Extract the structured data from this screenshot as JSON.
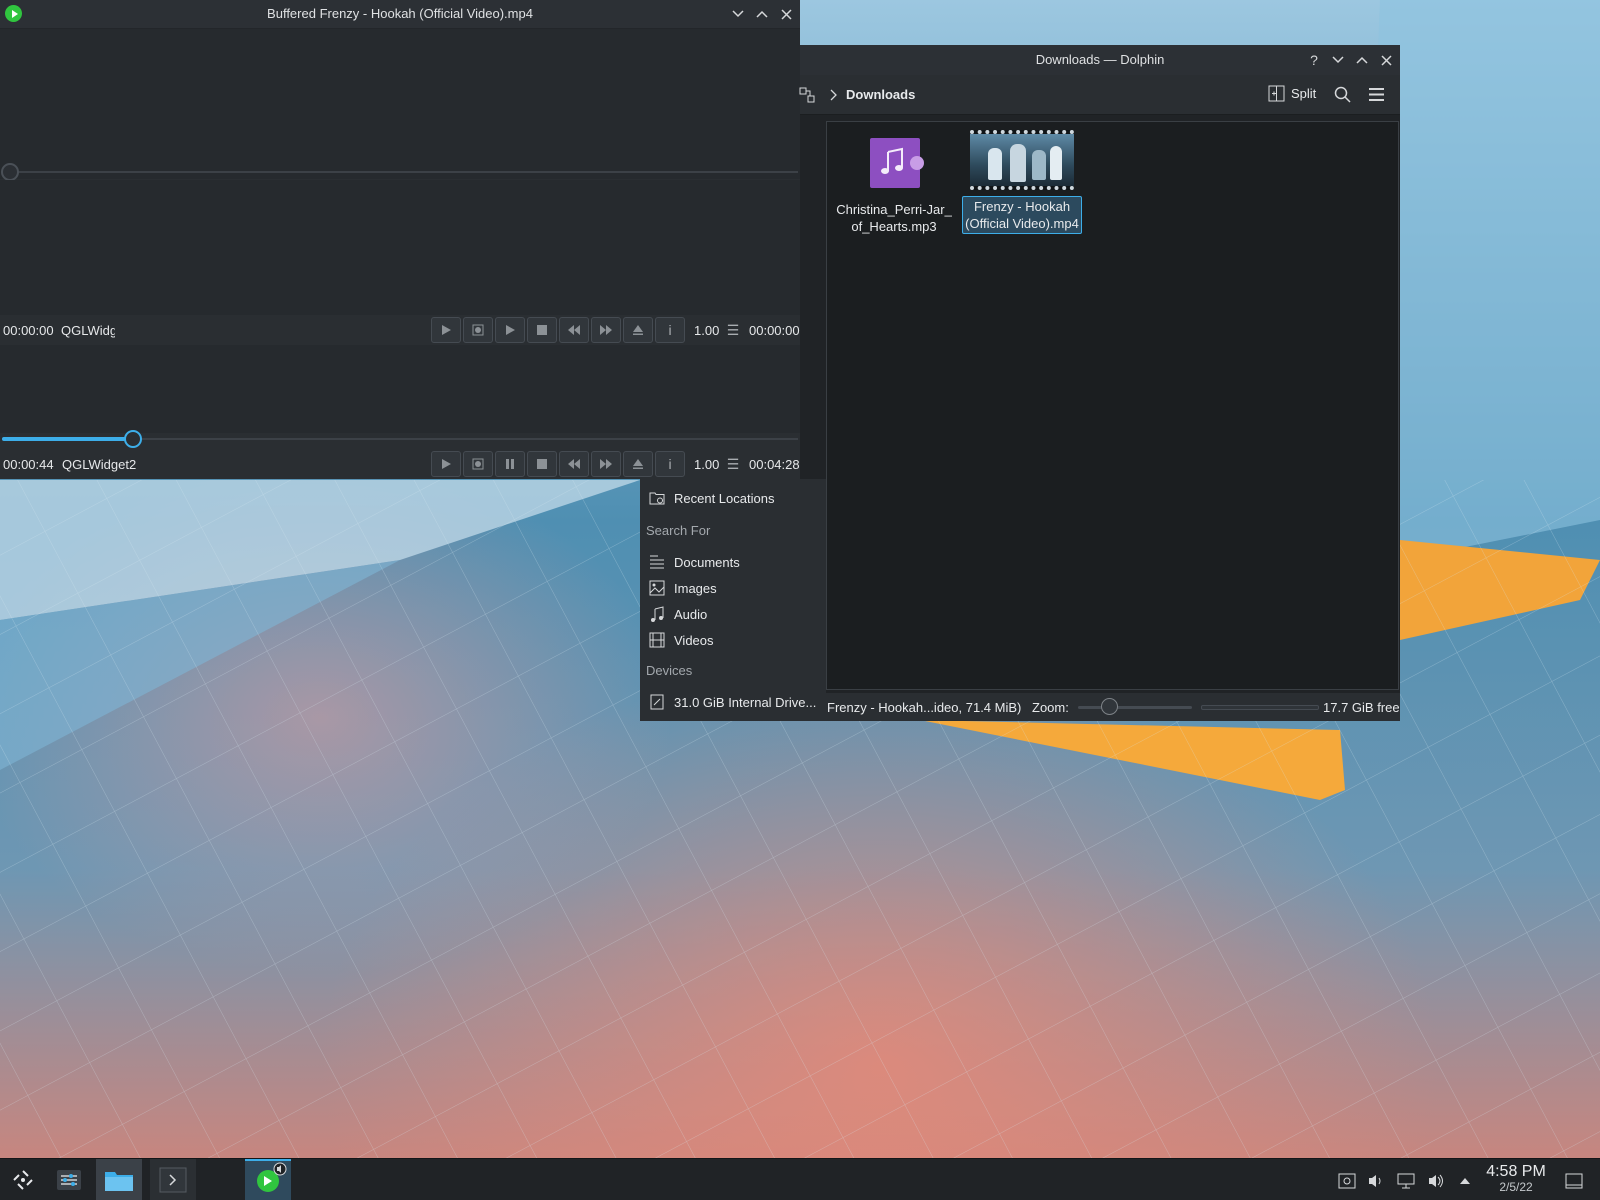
{
  "colors": {
    "accent": "#3daee9",
    "window_bg": "#2a2e32",
    "view_bg": "#1b1e20",
    "taskbar_bg": "#202326",
    "play_green": "#30c53f"
  },
  "player": {
    "title": "Buffered Frenzy - Hookah (Official Video).mp4",
    "pane1": {
      "time": "00:00:00",
      "widget": "QGLWidg",
      "speed": "1.00",
      "duration": "00:00:00",
      "progress": 0
    },
    "pane2": {
      "time": "00:00:44",
      "widget": "QGLWidget2",
      "speed": "1.00",
      "duration": "00:04:28",
      "progress": 0.164
    },
    "button_icons": [
      "play-icon",
      "record-icon",
      "play-pause-icon",
      "stop-icon",
      "rewind-icon",
      "forward-icon",
      "eject-icon",
      "info-icon"
    ],
    "info_glyph": "i",
    "menu_glyph": "☰"
  },
  "dolphin": {
    "title": "Downloads — Dolphin",
    "breadcrumb": "Downloads",
    "split_label": "Split",
    "files": [
      {
        "name": "Christina_Perri-Jar_of_Hearts.mp3",
        "label_line1": "Christina_Perri-Jar_",
        "label_line2": "of_Hearts.mp3",
        "type": "audio"
      },
      {
        "name": "Frenzy - Hookah (Official Video).mp4",
        "label_line1": "Frenzy - Hookah",
        "label_line2": "(Official Video).mp4",
        "type": "video",
        "selected": true
      }
    ],
    "status": {
      "selection": "Frenzy - Hookah...ideo, 71.4 MiB)",
      "zoom_label": "Zoom:",
      "free_space": "17.7 GiB free"
    }
  },
  "places": {
    "recent_locations": "Recent Locations",
    "search_for_header": "Search For",
    "search_items": [
      "Documents",
      "Images",
      "Audio",
      "Videos"
    ],
    "devices_header": "Devices",
    "device": "31.0 GiB Internal Drive..."
  },
  "taskbar": {
    "clock_time": "4:58 PM",
    "clock_date": "2/5/22"
  }
}
